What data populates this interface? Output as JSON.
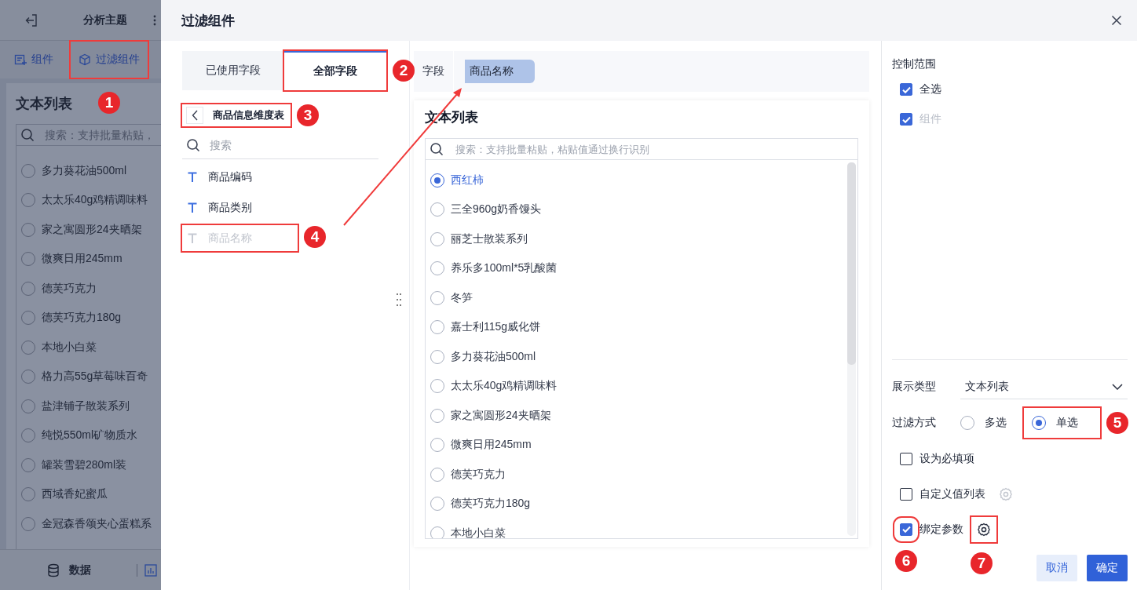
{
  "background_app": {
    "title": "分析主题",
    "toolbar": [
      {
        "label": "组件"
      },
      {
        "label": "过滤组件",
        "callout": "1"
      }
    ],
    "panel": {
      "title": "文本列表",
      "search": {
        "placeholder": "搜索：支持批量粘贴，"
      },
      "options": [
        {
          "label": "多力葵花油500ml",
          "selected": false
        },
        {
          "label": "太太乐40g鸡精调味料",
          "selected": false
        },
        {
          "label": "家之寓圆形24夹晒架",
          "selected": false
        },
        {
          "label": "微爽日用245mm",
          "selected": false
        },
        {
          "label": "德芙巧克力",
          "selected": false
        },
        {
          "label": "德芙巧克力180g",
          "selected": false
        },
        {
          "label": "本地小白菜",
          "selected": false
        },
        {
          "label": "格力高55g草莓味百奇",
          "selected": false
        },
        {
          "label": "盐津铺子散装系列",
          "selected": false
        },
        {
          "label": "纯悦550ml矿物质水",
          "selected": false
        },
        {
          "label": "罐装雪碧280ml装",
          "selected": false
        },
        {
          "label": "西域香妃蜜瓜",
          "selected": false
        },
        {
          "label": "金冠森香颂夹心蛋糕系",
          "selected": false
        }
      ]
    },
    "bottom_tab": {
      "label": "数据"
    }
  },
  "dialog": {
    "title": "过滤组件",
    "field_tabs": [
      {
        "label": "已使用字段",
        "selected": false
      },
      {
        "label": "全部字段",
        "selected": true,
        "callout": "2"
      }
    ],
    "table": {
      "name": "商品信息维度表",
      "callout": "3"
    },
    "field_search": {
      "placeholder": "搜索"
    },
    "fields": [
      {
        "name": "商品编码",
        "disabled": false
      },
      {
        "name": "商品类别",
        "disabled": false
      },
      {
        "name": "商品名称",
        "disabled": true,
        "callout": "4"
      }
    ],
    "field_slot": {
      "label": "字段",
      "value": "商品名称"
    },
    "preview": {
      "title": "文本列表",
      "search": {
        "placeholder": "搜索：支持批量粘贴，粘贴值通过换行识别"
      },
      "options": [
        {
          "label": "西红柿",
          "selected": true
        },
        {
          "label": "三全960g奶香馒头",
          "selected": false
        },
        {
          "label": "丽芝士散装系列",
          "selected": false
        },
        {
          "label": "养乐多100ml*5乳酸菌",
          "selected": false
        },
        {
          "label": "冬笋",
          "selected": false
        },
        {
          "label": "嘉士利115g威化饼",
          "selected": false
        },
        {
          "label": "多力葵花油500ml",
          "selected": false
        },
        {
          "label": "太太乐40g鸡精调味料",
          "selected": false
        },
        {
          "label": "家之寓圆形24夹晒架",
          "selected": false
        },
        {
          "label": "微爽日用245mm",
          "selected": false
        },
        {
          "label": "德芙巧克力",
          "selected": false
        },
        {
          "label": "德芙巧克力180g",
          "selected": false
        },
        {
          "label": "本地小白菜",
          "selected": false
        }
      ]
    },
    "settings": {
      "scope": {
        "title": "控制范围",
        "options": [
          {
            "label": "全选",
            "checked": true,
            "disabled": false
          },
          {
            "label": "组件",
            "checked": true,
            "disabled": true
          }
        ]
      },
      "display_type": {
        "label": "展示类型",
        "value": "文本列表"
      },
      "filter_mode": {
        "label": "过滤方式",
        "options": [
          {
            "label": "多选",
            "selected": false
          },
          {
            "label": "单选",
            "selected": true,
            "callout": "5"
          }
        ]
      },
      "options": [
        {
          "label": "设为必填项",
          "checked": false
        },
        {
          "label": "自定义值列表",
          "checked": false,
          "settings": {
            "enabled": false
          }
        },
        {
          "label": "绑定参数",
          "checked": true,
          "callout": "6",
          "settings": {
            "enabled": true,
            "callout": "7"
          }
        }
      ]
    },
    "buttons": [
      {
        "label": "取消",
        "kind": "secondary"
      },
      {
        "label": "确定",
        "kind": "primary"
      }
    ]
  }
}
